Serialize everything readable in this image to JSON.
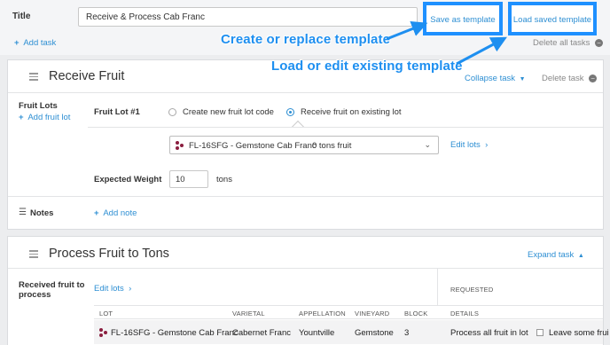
{
  "header": {
    "title_label": "Title",
    "title_value": "Receive & Process Cab Franc",
    "save_template": "Save as template",
    "load_template": "Load saved template",
    "add_task": "Add task",
    "delete_all": "Delete all tasks"
  },
  "callouts": {
    "create": "Create or replace template",
    "load": "Load or edit existing template"
  },
  "task1": {
    "title": "Receive Fruit",
    "collapse": "Collapse task",
    "delete": "Delete task",
    "fruit_lots_label": "Fruit Lots",
    "add_fruit_lot": "Add fruit lot",
    "lot_label": "Fruit Lot #1",
    "radio_new": "Create new fruit lot code",
    "radio_existing": "Receive fruit on existing lot",
    "lot_select": "FL-16SFG - Gemstone Cab Franc",
    "lot_tons": "0 tons fruit",
    "edit_lots": "Edit lots",
    "expected_weight_label": "Expected Weight",
    "expected_weight_value": "10",
    "weight_unit": "tons",
    "notes_label": "Notes",
    "add_note": "Add note"
  },
  "task2": {
    "title": "Process Fruit to Tons",
    "expand": "Expand task",
    "received_label": "Received fruit to process",
    "edit_lots": "Edit lots",
    "requested": "REQUESTED",
    "columns": [
      "LOT",
      "VARIETAL",
      "APPELLATION",
      "VINEYARD",
      "BLOCK",
      "DETAILS"
    ],
    "row": {
      "lot": "FL-16SFG - Gemstone Cab Franc",
      "varietal": "Cabernet Franc",
      "appellation": "Yountville",
      "vineyard": "Gemstone",
      "block": "3",
      "details": "Process all fruit in lot",
      "leave": "Leave some frui"
    }
  },
  "colors": {
    "accent": "#2e8fd3",
    "highlight": "#1e90ff",
    "wine": "#8b1e3f"
  }
}
